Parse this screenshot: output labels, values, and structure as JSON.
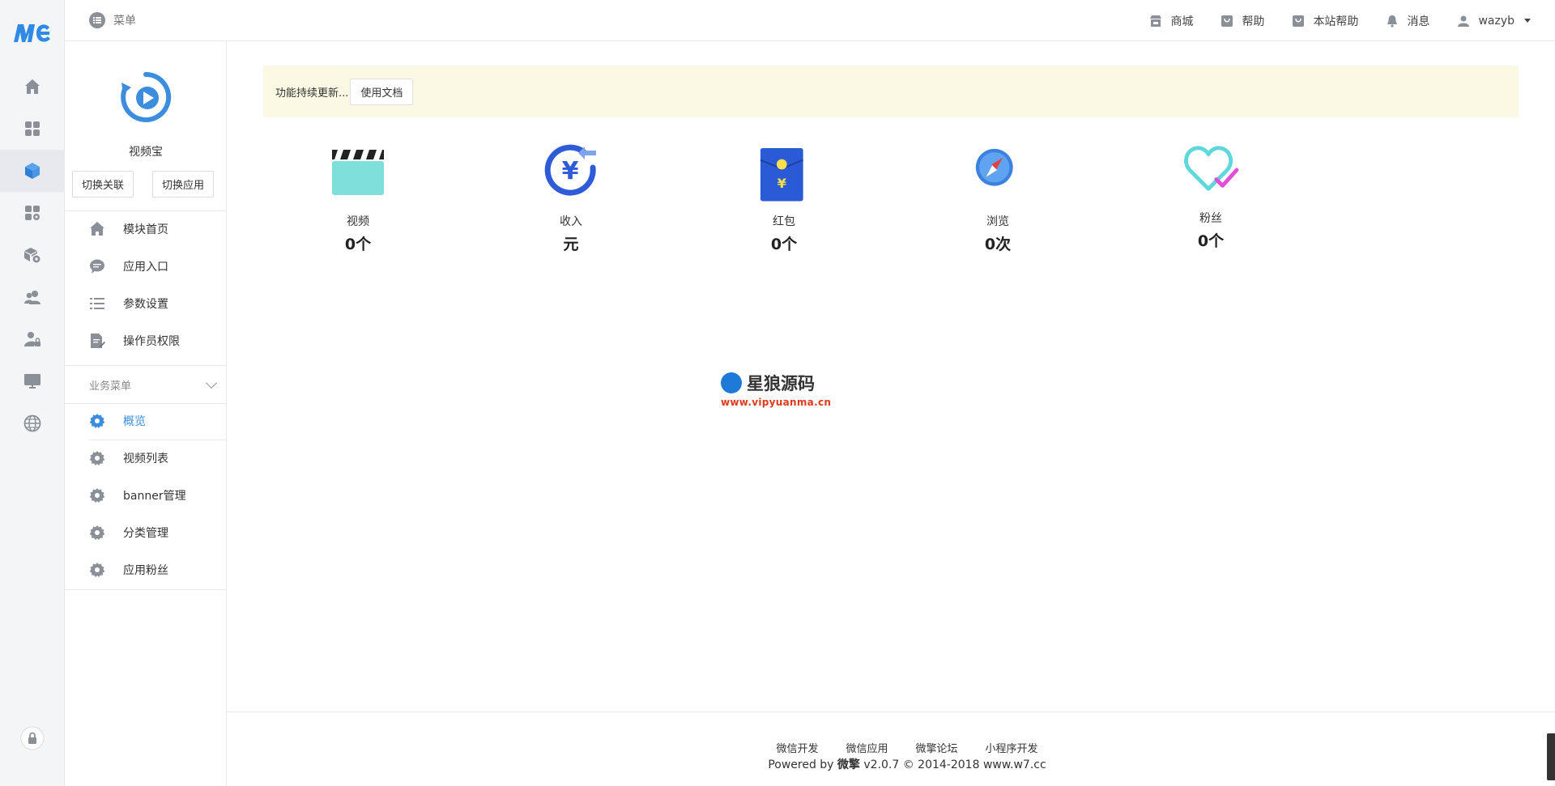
{
  "header": {
    "menu_label": "菜单",
    "links": [
      {
        "label": "商城",
        "icon": "shop-icon"
      },
      {
        "label": "帮助",
        "icon": "help-bag-icon"
      },
      {
        "label": "本站帮助",
        "icon": "site-help-icon"
      },
      {
        "label": "消息",
        "icon": "bell-icon"
      }
    ],
    "user": "wazyb"
  },
  "rail": {
    "items": [
      "home-icon",
      "apps-grid-icon",
      "module-cube-icon",
      "app-settings-icon",
      "store-settings-icon",
      "users-icon",
      "user-lock-icon",
      "monitor-icon",
      "globe-icon"
    ],
    "active_index": 2,
    "bottom": "lock-icon"
  },
  "sidebar": {
    "app_name": "视频宝",
    "switch_link": "切换关联",
    "switch_app": "切换应用",
    "items": [
      {
        "label": "模块首页",
        "icon": "home-icon"
      },
      {
        "label": "应用入口",
        "icon": "chat-icon"
      },
      {
        "label": "参数设置",
        "icon": "list-icon"
      },
      {
        "label": "操作员权限",
        "icon": "doc-edit-icon"
      }
    ],
    "section_title": "业务菜单",
    "biz_items": [
      {
        "label": "概览",
        "active": true
      },
      {
        "label": "视频列表",
        "active": false
      },
      {
        "label": "banner管理",
        "active": false
      },
      {
        "label": "分类管理",
        "active": false
      },
      {
        "label": "应用粉丝",
        "active": false
      }
    ]
  },
  "notice": {
    "text": "功能持续更新...",
    "doc_button": "使用文档"
  },
  "stats": [
    {
      "label": "视频",
      "value": "0个",
      "icon": "clapperboard-icon"
    },
    {
      "label": "收入",
      "value": "元",
      "icon": "yuan-income-icon"
    },
    {
      "label": "红包",
      "value": "0个",
      "icon": "red-envelope-icon"
    },
    {
      "label": "浏览",
      "value": "0次",
      "icon": "compass-icon"
    },
    {
      "label": "粉丝",
      "value": "0个",
      "icon": "heart-check-icon"
    }
  ],
  "watermark": {
    "line1": "星狼源码",
    "line2": "www.vipyuanma.cn"
  },
  "footer": {
    "links": [
      "微信开发",
      "微信应用",
      "微擎论坛",
      "小程序开发"
    ],
    "powered_prefix": "Powered by",
    "brand": "微擎",
    "version_text": "v2.0.7 © 2014-2018 www.w7.cc"
  },
  "colors": {
    "accent": "#3c8dde",
    "notice_bg": "#fbf8e3",
    "rail_bg": "#f4f5f7",
    "watermark_url": "#e03a1c"
  }
}
